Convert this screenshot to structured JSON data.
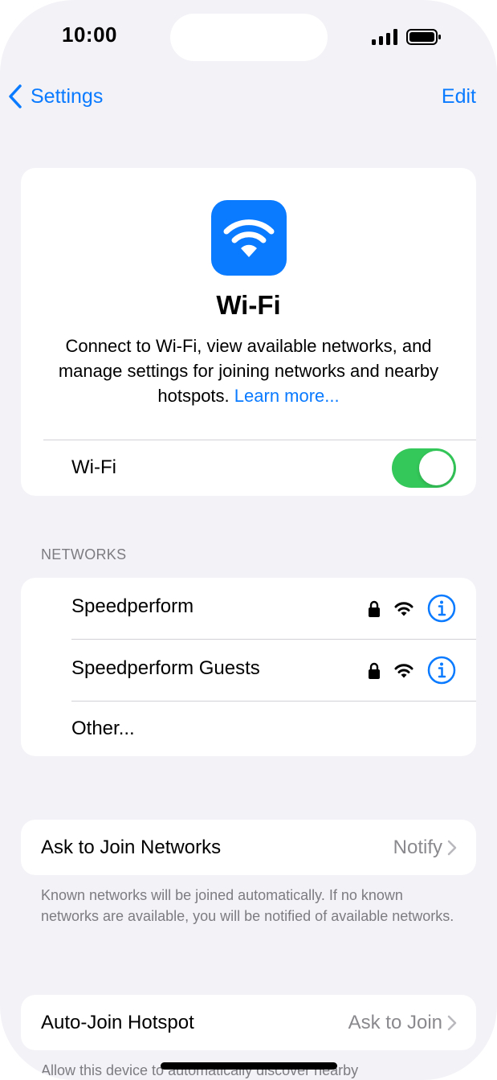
{
  "status_bar": {
    "time": "10:00"
  },
  "nav": {
    "back_label": "Settings",
    "edit_label": "Edit"
  },
  "hero": {
    "icon": "wifi-icon",
    "title": "Wi-Fi",
    "description": "Connect to Wi-Fi, view available networks, and manage settings for joining networks and nearby hotspots.",
    "learn_more": "Learn more...",
    "toggle_label": "Wi-Fi",
    "toggle_on": true
  },
  "networks": {
    "header": "NETWORKS",
    "items": [
      {
        "name": "Speedperform",
        "secured": true,
        "icons": [
          "lock-icon",
          "wifi-signal-icon",
          "info-icon"
        ]
      },
      {
        "name": "Speedperform Guests",
        "secured": true,
        "icons": [
          "lock-icon",
          "wifi-signal-icon",
          "info-icon"
        ]
      }
    ],
    "other_label": "Other..."
  },
  "ask_to_join": {
    "label": "Ask to Join Networks",
    "value": "Notify",
    "footnote": "Known networks will be joined automatically. If no known networks are available, you will be notified of available networks."
  },
  "auto_join": {
    "label": "Auto-Join Hotspot",
    "value": "Ask to Join",
    "footnote": "Allow this device to automatically discover nearby"
  },
  "colors": {
    "accent": "#0a7aff",
    "toggle_on": "#34c759",
    "background": "#f2f2f7",
    "secondary_text": "#8a8a8e"
  }
}
